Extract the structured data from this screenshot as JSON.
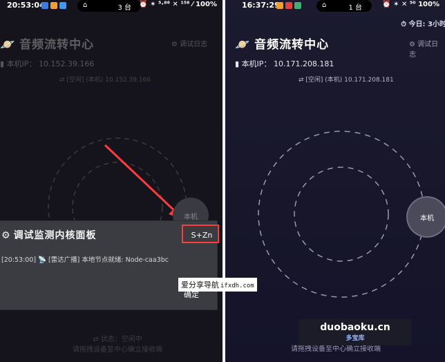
{
  "left": {
    "status": {
      "time": "20:53:04",
      "pill_text": "3 台",
      "right": "⏰ ✶ ⁵·⁸⁶ ✕ ¹⁵⁸ ⁄ 100%"
    },
    "title": "音频流转中心",
    "settings_label": "调试日志",
    "ip_label": "本机IP：",
    "ip_value": "10.152.39.166",
    "mode_line": "⇄ [空闲] (本机) 10.152.39.166",
    "node_label": "本机",
    "panel": {
      "title": "调试监测内核面板",
      "sz_button": "S+Zn",
      "log_line": "[20:53:00] 📡 [雷达广播] 本地节点就绪: Node-caa3bc",
      "confirm": "确定"
    },
    "bottom_status_1": "⇄ 状态：空闲中",
    "bottom_status_2": "请拖拽设备至中心确立接收端"
  },
  "right": {
    "status": {
      "time": "16:37:29",
      "pill_text": "1 台",
      "right": "⏰ ✶ ✕ ⁵⁰ 100%"
    },
    "today_label": "⏱ 今日: 3小时",
    "title": "音频流转中心",
    "settings_label": "调试日志",
    "ip_label": "本机IP：",
    "ip_value": "10.171.208.181",
    "mode_line": "⇄ [空闲] (本机) 10.171.208.181",
    "node_label": "本机",
    "bottom_status": "请拖拽设备至中心确立接收端"
  },
  "watermarks": {
    "wm1_main": "爱分享导航",
    "wm1_sub": "ifxdh.com",
    "wm2_main": "duobaoku.cn",
    "wm2_sub": "多宝库"
  },
  "colors": {
    "accent_red": "#ff3b3b",
    "panel": "#3b3c42"
  }
}
